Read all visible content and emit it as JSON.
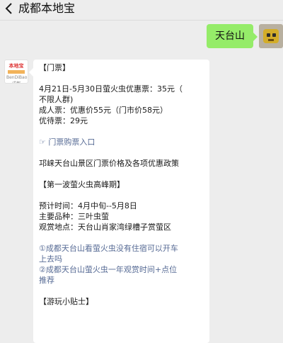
{
  "header": {
    "title": "成都本地宝"
  },
  "outgoing": {
    "text": "天台山"
  },
  "avatar_bot": {
    "top_label": "本地宝",
    "bottom_label": "BenDiBao 成都"
  },
  "reply": {
    "section_ticket": "【门票】",
    "ticket_line1": "4月21日-5月30日萤火虫优惠票：35元（",
    "ticket_line2": "不限人群)",
    "ticket_adult": "成人票：优惠价55元（门市价58元）",
    "ticket_discount": "优待票：29元",
    "ticket_link": "☞ 门票购票入口",
    "policy_title": "邛崃天台山景区门票价格及各项优惠政策",
    "section_firefly": "【第一波萤火虫高峰期】",
    "time": "预计时间：4月中旬--5月8日",
    "species": "主要品种：三叶虫萤",
    "place": "观赏地点：天台山肖家湾绿槽子赏萤区",
    "link1_line1": "①成都天台山看萤火虫没有住宿可以开车",
    "link1_line2": "上去吗",
    "link2_line1": "②成都天台山萤火虫一年观赏时间+点位",
    "link2_line2": "推荐",
    "section_tips": "【游玩小贴士】"
  },
  "colors": {
    "bg": "#ededed",
    "out_bubble": "#95ec69",
    "in_bubble": "#ffffff",
    "link": "#576b95"
  }
}
